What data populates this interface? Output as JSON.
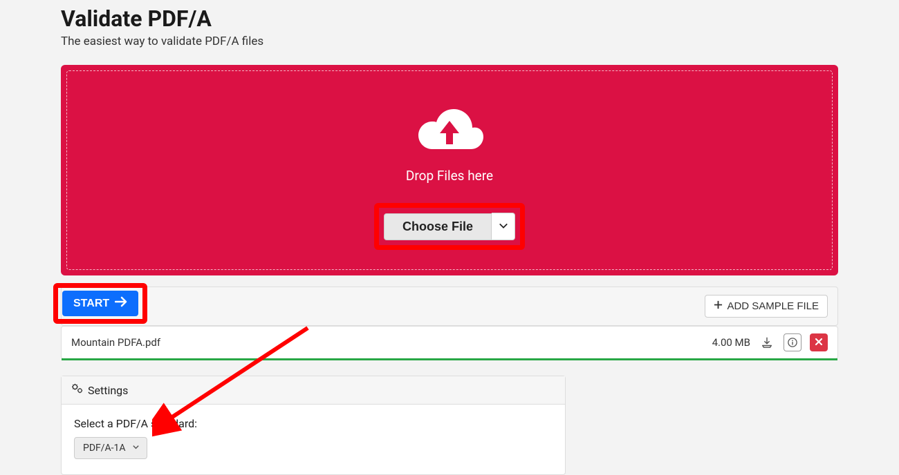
{
  "header": {
    "title": "Validate PDF/A",
    "subtitle": "The easiest way to validate PDF/A files"
  },
  "dropzone": {
    "text": "Drop Files here",
    "choose_label": "Choose File"
  },
  "toolbar": {
    "start_label": "START",
    "add_sample_label": "ADD SAMPLE FILE"
  },
  "file": {
    "name": "Mountain PDFA.pdf",
    "size": "4.00 MB"
  },
  "settings": {
    "title": "Settings",
    "select_label": "Select a PDF/A standard:",
    "selected_standard": "PDF/A-1A"
  },
  "colors": {
    "accent": "#db1144",
    "primary": "#0d6efd",
    "success": "#28a745",
    "danger": "#dc3545",
    "highlight": "#ff0000"
  }
}
